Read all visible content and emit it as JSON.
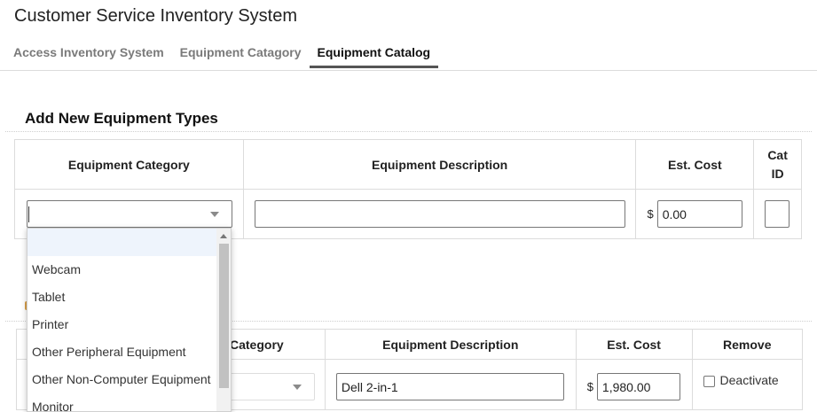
{
  "app": {
    "title": "Customer Service Inventory System"
  },
  "tabs": [
    {
      "label": "Access Inventory System",
      "active": false
    },
    {
      "label": "Equipment Catagory",
      "active": false
    },
    {
      "label": "Equipment Catalog",
      "active": true
    }
  ],
  "add_section": {
    "title": "Add New Equipment Types",
    "headers": {
      "category": "Equipment Category",
      "description": "Equipment Description",
      "cost": "Est. Cost",
      "catid": "Cat ID"
    },
    "row": {
      "category_value": "",
      "description_value": "",
      "currency": "$",
      "cost_value": "0.00",
      "catid_value": ""
    }
  },
  "dropdown": {
    "options": [
      "",
      "Webcam",
      "Tablet",
      "Printer",
      "Other Peripheral Equipment",
      "Other Non-Computer Equipment",
      "Monitor"
    ]
  },
  "catalog_table": {
    "headers": {
      "category": "Category",
      "description": "Equipment Description",
      "cost": "Est. Cost",
      "remove": "Remove"
    },
    "rows": [
      {
        "category_value": "",
        "description": "Dell 2-in-1",
        "currency": "$",
        "cost": "1,980.00",
        "remove_label": "Deactivate",
        "checked": false
      }
    ]
  },
  "colors": {
    "accent": "#555555",
    "inactive_tab": "#7a7a7a",
    "dropdown_highlight": "#eef4fc"
  }
}
